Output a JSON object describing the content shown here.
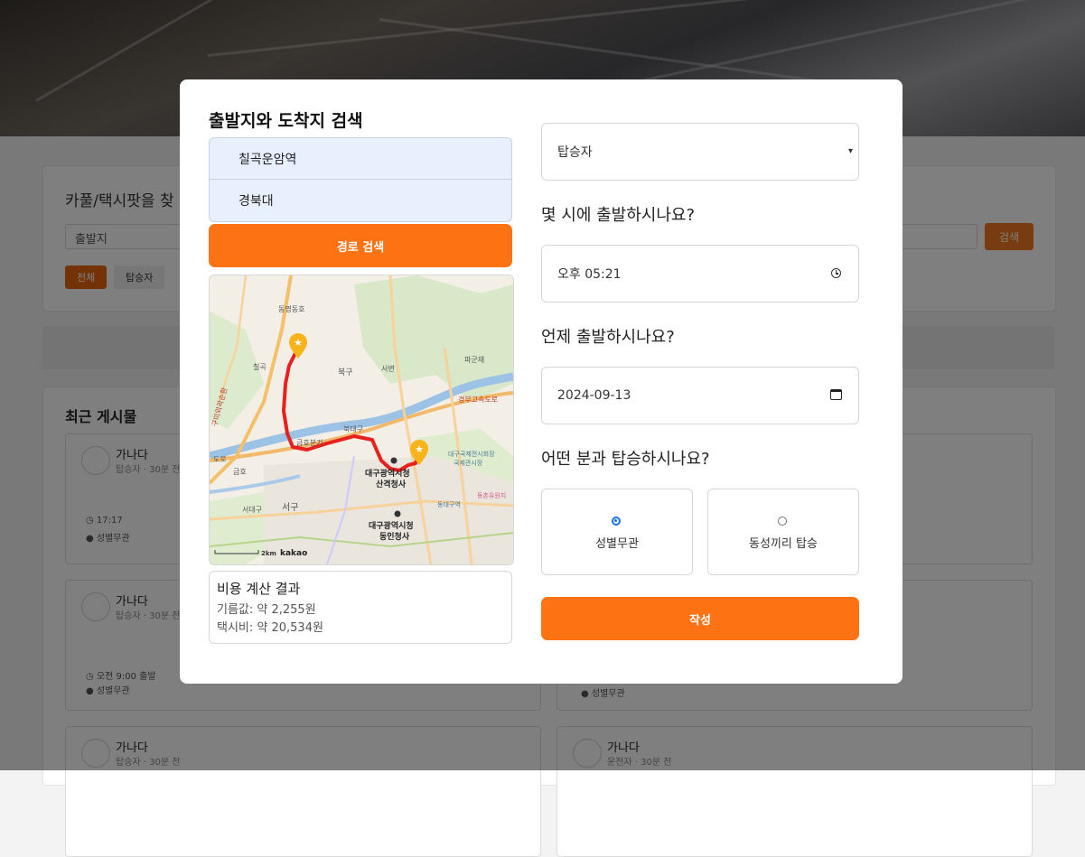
{
  "background": {
    "search": {
      "title": "카풀/택시팟을 찾",
      "departure_placeholder": "출발지",
      "search_button": "검색",
      "filters": [
        "전체",
        "탑승자"
      ]
    },
    "recent": {
      "title": "최근 게시물",
      "posts": [
        {
          "name": "가나다",
          "meta": "탑승자 · 30분 전",
          "time": "17:17",
          "gender": "성별무관"
        },
        {
          "name": "가나다",
          "meta": "탑승자 · 30분 전",
          "time": "오전 9:00 출발",
          "gender": "성별무관"
        },
        {
          "name": "가나다",
          "meta": "탑승자 · 30분 전"
        },
        {
          "name": "가나다",
          "meta": "운전자 · 30분 전"
        }
      ],
      "right_gender": "성별무관"
    }
  },
  "modal": {
    "title": "출발지와 도착지 검색",
    "start_location": "칠곡운암역",
    "end_location": "경북대",
    "route_button": "경로 검색",
    "map": {
      "labels": {
        "dongmyeong": "동명동호",
        "chilgok": "칠곡",
        "bukgu": "북구",
        "seobyeon": "서변",
        "pagye": "파군재",
        "expressway": "경부고속도로",
        "ring_road": "구미외곽순환",
        "geumho_jct": "금호분기",
        "buk_daegu": "북대구",
        "geumho": "금호",
        "seodaegu": "서대구",
        "seogu": "서구",
        "city_hall_sanyeok_1": "대구광역시청",
        "city_hall_sanyeok_2": "산격청사",
        "city_hall_dongin_1": "대구광역시청",
        "city_hall_dongin_2": "동인청사",
        "exco_1": "대구국제전시회장",
        "exco_2": "국제관시장",
        "dongdaegu": "동대구역",
        "shinsegae": "동촌유원지",
        "road": "도로",
        "scale": "2km",
        "brand": "kakao"
      }
    },
    "cost": {
      "title": "비용 계산 결과",
      "fuel": "기름값: 약 2,255원",
      "taxi": "택시비: 약 20,534원"
    },
    "role_select": "탑승자",
    "q_time": "몇 시에 출발하시나요?",
    "time_value": "오후 05:21",
    "q_date": "언제 출발하시나요?",
    "date_value": "2024-09-13",
    "q_gender": "어떤 분과 탑승하시나요?",
    "gender_options": [
      {
        "label": "성별무관",
        "selected": true
      },
      {
        "label": "동성끼리 탑승",
        "selected": false
      }
    ],
    "submit_button": "작성"
  },
  "colors": {
    "accent": "#fd7314",
    "route_line": "#e8201e",
    "marker": "#f9b31b",
    "radio_selected": "#1a73e8",
    "input_autofill": "#e8f0fe"
  }
}
